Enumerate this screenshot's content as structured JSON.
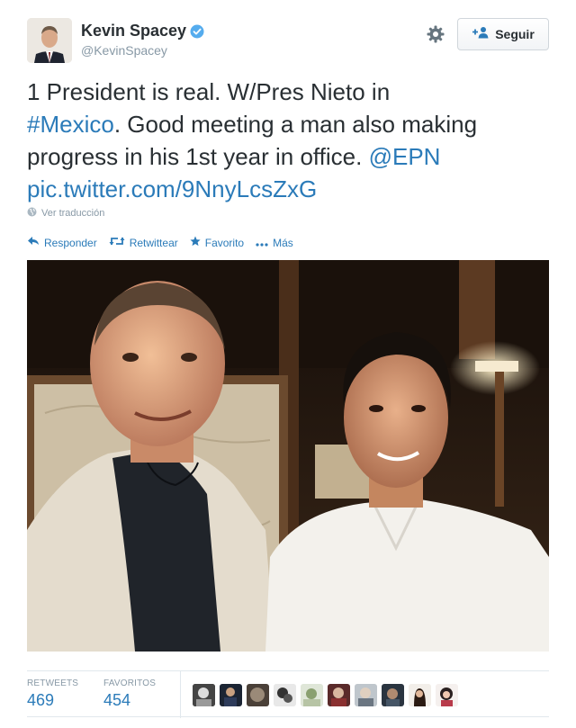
{
  "user": {
    "fullname": "Kevin Spacey",
    "username": "@KevinSpacey",
    "verified_icon": "verified-badge-icon"
  },
  "follow": {
    "label": "Seguir",
    "icon": "add-user-icon"
  },
  "settings": {
    "icon": "gear-icon"
  },
  "tweet": {
    "line1": "1 President is real. W/Pres Nieto in",
    "hashtag": "#Mexico",
    "line2_rest": ". Good meeting a man also making",
    "line3": "progress in his 1st year in office. ",
    "mention": "@EPN",
    "link": "pic.twitter.com/9NnyLcsZxG"
  },
  "translate": {
    "label": "Ver traducción",
    "icon": "globe-icon"
  },
  "actions": {
    "reply": "Responder",
    "retweet": "Retwittear",
    "favorite": "Favorito",
    "more": "Más"
  },
  "stats": {
    "retweets_label": "RETWEETS",
    "retweets_value": "469",
    "favorites_label": "FAVORITOS",
    "favorites_value": "454"
  },
  "colors": {
    "link": "#2b7bb9",
    "text": "#292f33",
    "muted": "#8899a6",
    "verified": "#55acee"
  }
}
